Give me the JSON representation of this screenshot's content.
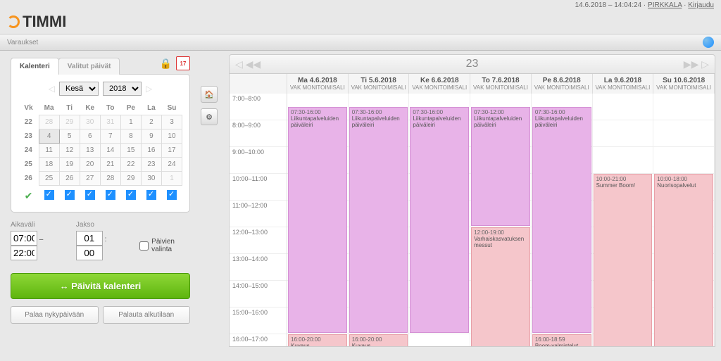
{
  "topbar": {
    "datetime": "14.6.2018 – 14:04:24",
    "tenant": "PIRKKALA",
    "login": "Kirjaudu"
  },
  "logo": "TIMMI",
  "subtitle": "Varaukset",
  "tabs": {
    "calendar": "Kalenteri",
    "selected": "Valitut päivät"
  },
  "monthSelect": {
    "month": "Kesä",
    "year": "2018"
  },
  "miniCal": {
    "headers": [
      "Vk",
      "Ma",
      "Ti",
      "Ke",
      "To",
      "Pe",
      "La",
      "Su"
    ],
    "rows": [
      {
        "wk": "22",
        "days": [
          {
            "n": "28",
            "out": true
          },
          {
            "n": "29",
            "out": true
          },
          {
            "n": "30",
            "out": true
          },
          {
            "n": "31",
            "out": true
          },
          {
            "n": "1"
          },
          {
            "n": "2"
          },
          {
            "n": "3"
          }
        ]
      },
      {
        "wk": "23",
        "days": [
          {
            "n": "4",
            "sel": true
          },
          {
            "n": "5"
          },
          {
            "n": "6"
          },
          {
            "n": "7"
          },
          {
            "n": "8"
          },
          {
            "n": "9"
          },
          {
            "n": "10"
          }
        ]
      },
      {
        "wk": "24",
        "days": [
          {
            "n": "11"
          },
          {
            "n": "12"
          },
          {
            "n": "13"
          },
          {
            "n": "14"
          },
          {
            "n": "15"
          },
          {
            "n": "16"
          },
          {
            "n": "17"
          }
        ]
      },
      {
        "wk": "25",
        "days": [
          {
            "n": "18"
          },
          {
            "n": "19"
          },
          {
            "n": "20"
          },
          {
            "n": "21"
          },
          {
            "n": "22"
          },
          {
            "n": "23"
          },
          {
            "n": "24"
          }
        ]
      },
      {
        "wk": "26",
        "days": [
          {
            "n": "25"
          },
          {
            "n": "26"
          },
          {
            "n": "27"
          },
          {
            "n": "28"
          },
          {
            "n": "29"
          },
          {
            "n": "30"
          },
          {
            "n": "1",
            "out": true
          }
        ]
      }
    ]
  },
  "timeRange": {
    "labelTime": "Aikaväli",
    "labelPeriod": "Jakso",
    "from": "07:00",
    "to": "22:00",
    "pHour": "01",
    "pMin": "00",
    "daySelect": "Päivien valinta",
    "dash": "–",
    "colon": ":"
  },
  "buttons": {
    "refresh": "↔ Päivitä kalenteri",
    "today": "Palaa nykypäivään",
    "reset": "Palauta alkutilaan"
  },
  "calendar": {
    "week": "23",
    "room": "VAK MONITOIMISALI",
    "days": [
      "Ma 4.6.2018",
      "Ti 5.6.2018",
      "Ke 6.6.2018",
      "To 7.6.2018",
      "Pe 8.6.2018",
      "La 9.6.2018",
      "Su 10.6.2018"
    ],
    "timeSlots": [
      "7:00–8:00",
      "8:00–9:00",
      "9:00–10:00",
      "10:00–11:00",
      "11:00–12:00",
      "12:00–13:00",
      "13:00–14:00",
      "14:00–15:00",
      "15:00–16:00",
      "16:00–17:00"
    ],
    "events": [
      {
        "col": 0,
        "startRow": 0,
        "rows": 9,
        "time": "07:30-16:00",
        "title": "Liikuntapalveluiden päiväleiri",
        "cls": ""
      },
      {
        "col": 1,
        "startRow": 0,
        "rows": 9,
        "time": "07:30-16:00",
        "title": "Liikuntapalveluiden päiväleiri",
        "cls": ""
      },
      {
        "col": 2,
        "startRow": 0,
        "rows": 9,
        "time": "07:30-16:00",
        "title": "Liikuntapalveluiden päiväleiri",
        "cls": ""
      },
      {
        "col": 3,
        "startRow": 0,
        "rows": 5,
        "time": "07:30-12:00",
        "title": "Liikuntapalveluiden päiväleiri",
        "cls": ""
      },
      {
        "col": 4,
        "startRow": 0,
        "rows": 9,
        "time": "07:30-16:00",
        "title": "Liikuntapalveluiden päiväleiri",
        "cls": ""
      },
      {
        "col": 3,
        "startRow": 5,
        "rows": 5,
        "time": "12:00-19:00",
        "title": "Varhaiskasvatuksen messut",
        "cls": "pink"
      },
      {
        "col": 5,
        "startRow": 3,
        "rows": 7,
        "time": "10:00-21:00",
        "title": "Summer Boom!",
        "cls": "pink"
      },
      {
        "col": 6,
        "startRow": 3,
        "rows": 7,
        "time": "10:00-18:00",
        "title": "Nuorisopalvelut",
        "cls": "pink"
      },
      {
        "col": 0,
        "startRow": 9,
        "rows": 1,
        "time": "16:00-20:00",
        "title": "Kuvaus",
        "cls": "pink"
      },
      {
        "col": 1,
        "startRow": 9,
        "rows": 1,
        "time": "16:00-20:00",
        "title": "Kuvaus",
        "cls": "pink"
      },
      {
        "col": 4,
        "startRow": 9,
        "rows": 1,
        "time": "16:00-18:59",
        "title": "Boom-valmistelut",
        "cls": "pink"
      }
    ]
  },
  "calIcon": "17"
}
